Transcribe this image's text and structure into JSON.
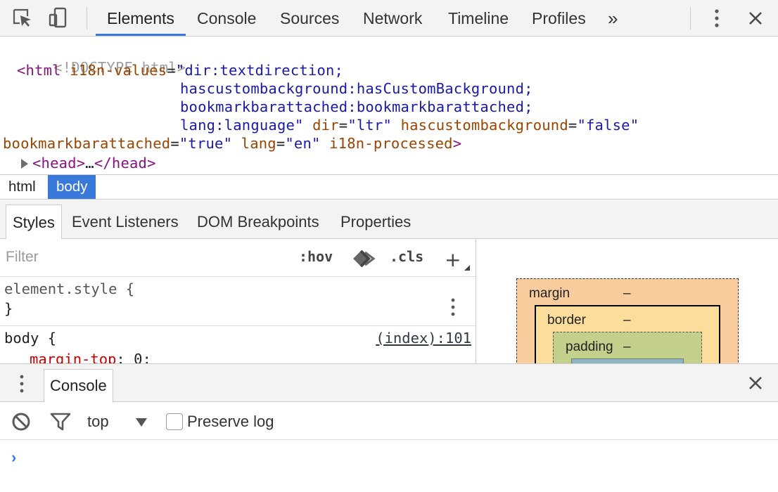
{
  "toolbar": {
    "tabs": [
      "Elements",
      "Console",
      "Sources",
      "Network",
      "Timeline",
      "Profiles"
    ],
    "overflow": "»",
    "icons": [
      "inspect-icon",
      "device-mode-icon",
      "more-vert-icon",
      "close-icon"
    ]
  },
  "dom": {
    "doctype": "<!DOCTYPE html>",
    "html_open": "<html",
    "attr1_name": "i18n-values",
    "attr1_val_line1": "\"dir:textdirection;",
    "attr1_val_line2": "hascustombackground:hasCustomBackground;",
    "attr1_val_line3": "bookmarkbarattached:bookmarkbarattached;",
    "attr1_val_line4": "lang:language\"",
    "dir_name": "dir",
    "dir_val": "\"ltr\"",
    "hcb_name": "hascustombackground",
    "hcb_val": "\"false\"",
    "bba_name": "bookmarkbarattached",
    "bba_val": "\"true\"",
    "lang_name": "lang",
    "lang_val": "\"en\"",
    "proc_name": "i18n-processed",
    "head_open": "<head>",
    "head_ellipsis": "…",
    "head_close": "</head>"
  },
  "breadcrumbs": [
    "html",
    "body"
  ],
  "subtabs": [
    "Styles",
    "Event Listeners",
    "DOM Breakpoints",
    "Properties"
  ],
  "styles": {
    "filter_placeholder": "Filter",
    "hov": ":hov",
    "cls": ".cls",
    "add": "+",
    "element_style_selector": "element.style {",
    "close_brace": "}",
    "body_selector": "body {",
    "body_source": "(index):101",
    "prop_name": "margin-top",
    "prop_value": "0;"
  },
  "box_model": {
    "margin_label": "margin",
    "margin_value": "–",
    "border_label": "border",
    "border_value": "–",
    "padding_label": "padding",
    "padding_value": "–"
  },
  "drawer": {
    "tab": "Console",
    "context": "top",
    "preserve_log": "Preserve log",
    "preserve_checked": false,
    "prompt": "›"
  },
  "colors": {
    "accent": "#3879d9",
    "tag": "#881280",
    "attr": "#994500",
    "value": "#1a1aa6",
    "prop": "#c80000"
  }
}
